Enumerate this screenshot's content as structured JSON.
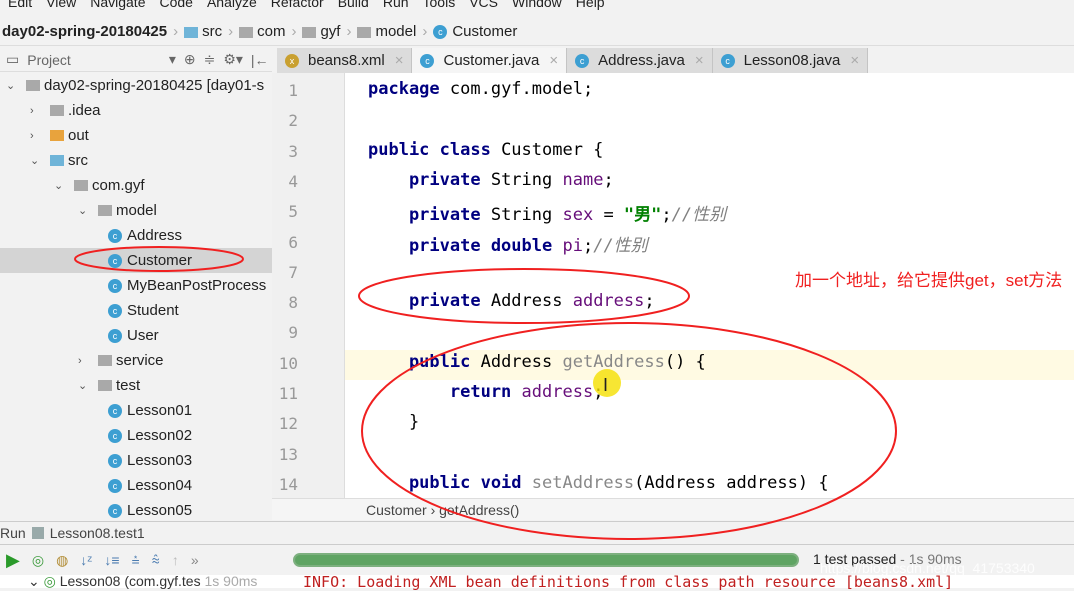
{
  "menu": [
    "Edit",
    "View",
    "Navigate",
    "Code",
    "Analyze",
    "Refactor",
    "Build",
    "Run",
    "Tools",
    "VCS",
    "Window",
    "Help"
  ],
  "breadcrumb": [
    "day02-spring-20180425",
    "src",
    "com",
    "gyf",
    "model",
    "Customer"
  ],
  "project_panel": {
    "title": "Project"
  },
  "tabs": [
    {
      "label": "beans8.xml",
      "active": false
    },
    {
      "label": "Customer.java",
      "active": true
    },
    {
      "label": "Address.java",
      "active": false
    },
    {
      "label": "Lesson08.java",
      "active": false
    }
  ],
  "tree": [
    {
      "label": "day02-spring-20180425 [day01-s",
      "depth": 0,
      "arrow": "v",
      "icon": "module"
    },
    {
      "label": ".idea",
      "depth": 1,
      "arrow": ">",
      "icon": "folder"
    },
    {
      "label": "out",
      "depth": 1,
      "arrow": ">",
      "icon": "folder-orange"
    },
    {
      "label": "src",
      "depth": 1,
      "arrow": "v",
      "icon": "folder-blue"
    },
    {
      "label": "com.gyf",
      "depth": 2,
      "arrow": "v",
      "icon": "package"
    },
    {
      "label": "model",
      "depth": 3,
      "arrow": "v",
      "icon": "package"
    },
    {
      "label": "Address",
      "depth": 4,
      "arrow": "",
      "icon": "class"
    },
    {
      "label": "Customer",
      "depth": 4,
      "arrow": "",
      "icon": "class",
      "selected": true
    },
    {
      "label": "MyBeanPostProcess",
      "depth": 4,
      "arrow": "",
      "icon": "class"
    },
    {
      "label": "Student",
      "depth": 4,
      "arrow": "",
      "icon": "class"
    },
    {
      "label": "User",
      "depth": 4,
      "arrow": "",
      "icon": "class"
    },
    {
      "label": "service",
      "depth": 3,
      "arrow": ">",
      "icon": "package"
    },
    {
      "label": "test",
      "depth": 3,
      "arrow": "v",
      "icon": "package"
    },
    {
      "label": "Lesson01",
      "depth": 4,
      "arrow": "",
      "icon": "test-class"
    },
    {
      "label": "Lesson02",
      "depth": 4,
      "arrow": "",
      "icon": "test-class"
    },
    {
      "label": "Lesson03",
      "depth": 4,
      "arrow": "",
      "icon": "test-class"
    },
    {
      "label": "Lesson04",
      "depth": 4,
      "arrow": "",
      "icon": "test-class"
    },
    {
      "label": "Lesson05",
      "depth": 4,
      "arrow": "",
      "icon": "test-class"
    }
  ],
  "code": [
    [
      [
        "kw",
        "package "
      ],
      [
        "",
        "com.gyf.model;"
      ]
    ],
    [],
    [
      [
        "kw",
        "public class "
      ],
      [
        "",
        "Customer {"
      ]
    ],
    [
      [
        "kw",
        "    private "
      ],
      [
        "",
        "String "
      ],
      [
        "fd",
        "name"
      ],
      [
        "",
        ";"
      ]
    ],
    [
      [
        "kw",
        "    private "
      ],
      [
        "",
        "String "
      ],
      [
        "fd",
        "sex"
      ],
      [
        "",
        " = "
      ],
      [
        "st",
        "\"男\""
      ],
      [
        "",
        ";"
      ],
      [
        "cm",
        "//性别"
      ]
    ],
    [
      [
        "kw",
        "    private double "
      ],
      [
        "fd",
        "pi"
      ],
      [
        "",
        ";"
      ],
      [
        "cm",
        "//性别"
      ]
    ],
    [],
    [
      [
        "kw",
        "    private "
      ],
      [
        "",
        "Address "
      ],
      [
        "fd",
        "address"
      ],
      [
        "",
        ";"
      ]
    ],
    [],
    [
      [
        "kw",
        "    public "
      ],
      [
        "",
        "Address "
      ],
      [
        "mt",
        "getAddress"
      ],
      [
        "",
        "() {"
      ]
    ],
    [
      [
        "kw",
        "        return "
      ],
      [
        "fd",
        "address"
      ],
      [
        "",
        ";"
      ]
    ],
    [
      [
        "",
        "    }"
      ]
    ],
    [],
    [
      [
        "kw",
        "    public void "
      ],
      [
        "mt",
        "setAddress"
      ],
      [
        "",
        "(Address address) {"
      ]
    ]
  ],
  "editor_breadcrumb": "Customer  ›  getAddress()",
  "annotation": "加一个地址，给它提供get，set方法",
  "run": {
    "label": "Run",
    "config": "Lesson08.test1",
    "progress": 1.0,
    "status": "1 test passed",
    "time": " - 1s 90ms",
    "tree_item": "Lesson08 (com.gyf.tes",
    "tree_time": "1s 90ms",
    "console": "INFO: Loading XML bean definitions from class path resource [beans8.xml]"
  },
  "watermark": "https://blog.csdn.net/qq_41753340",
  "colors": {
    "annotation": "#f02020",
    "keyword": "#000080",
    "field": "#660e7a",
    "string": "#008000",
    "progress": "#5fa463"
  }
}
